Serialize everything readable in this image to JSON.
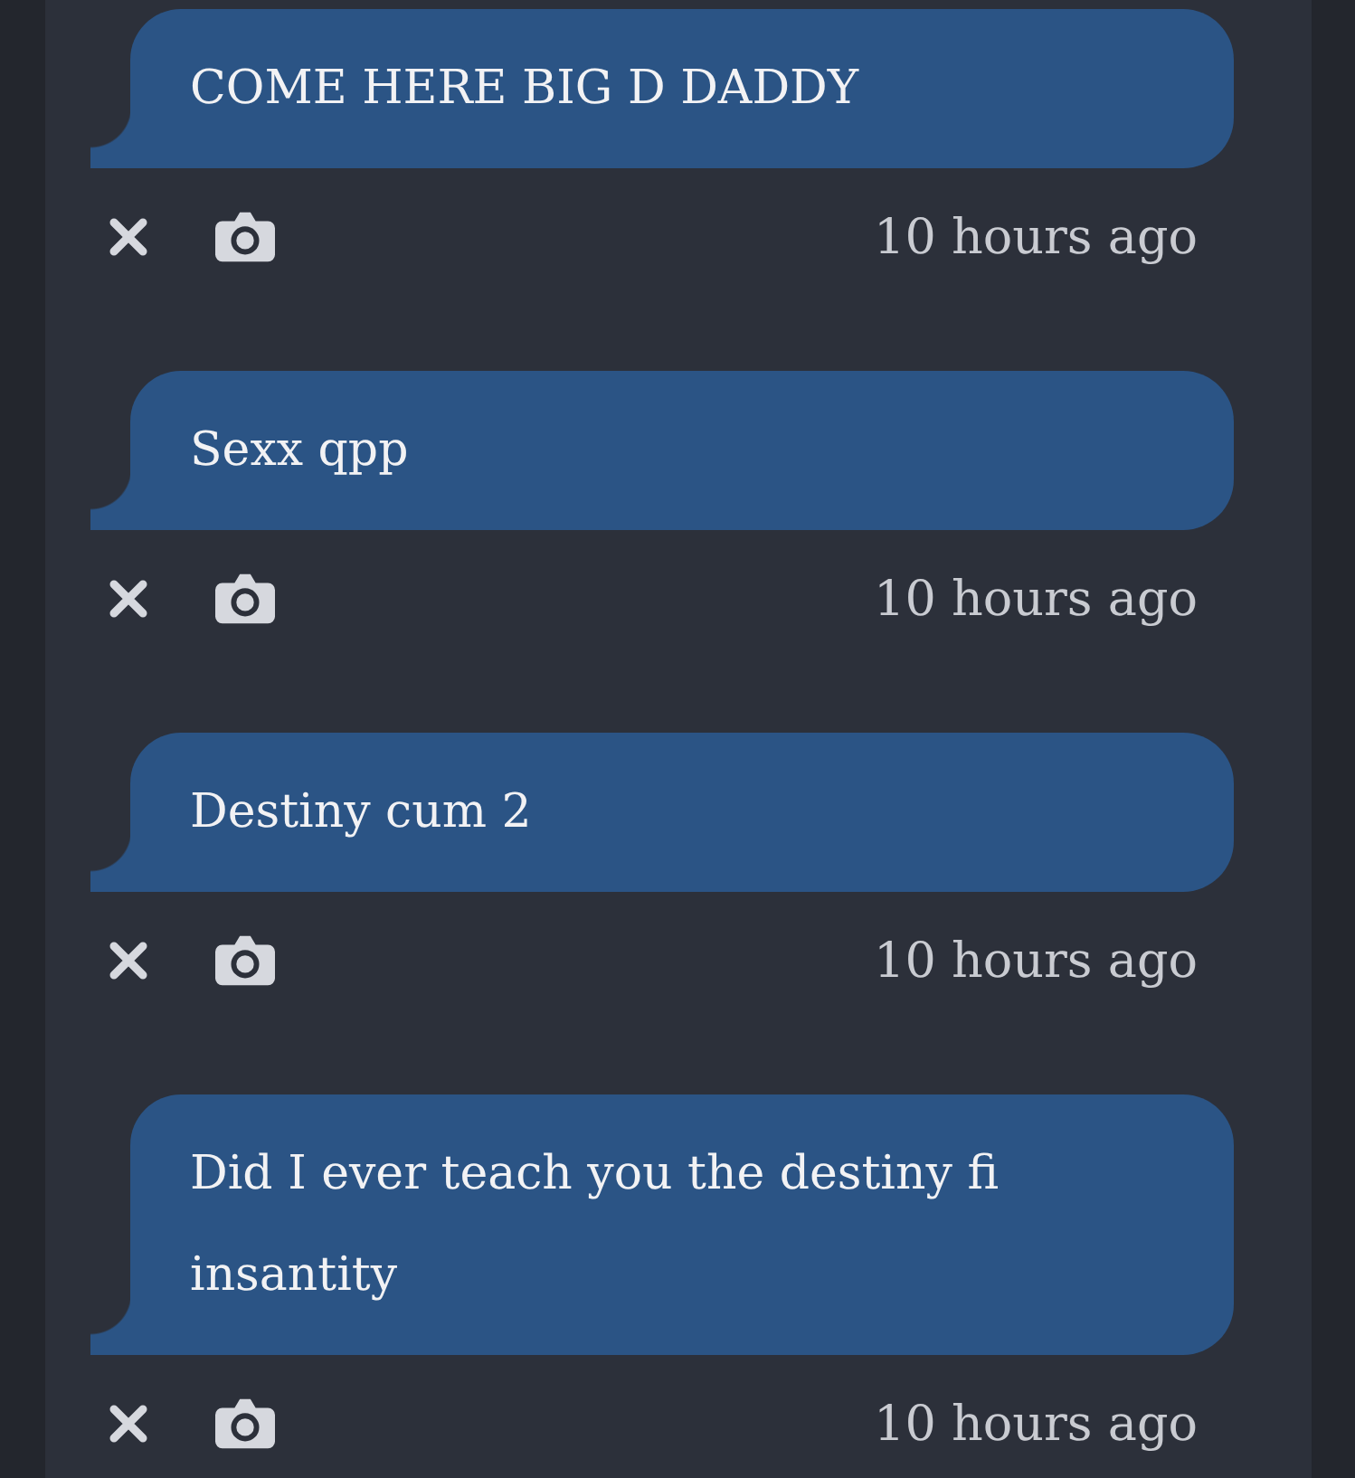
{
  "messages": [
    {
      "text": "COME HERE BIG D DADDY",
      "time": "10 hours ago"
    },
    {
      "text": "Sexx qpp",
      "time": "10 hours ago"
    },
    {
      "text": "Destiny cum 2",
      "time": "10 hours ago"
    },
    {
      "text": "Did I ever teach you the destiny fi insantity",
      "time": "10 hours ago"
    }
  ]
}
